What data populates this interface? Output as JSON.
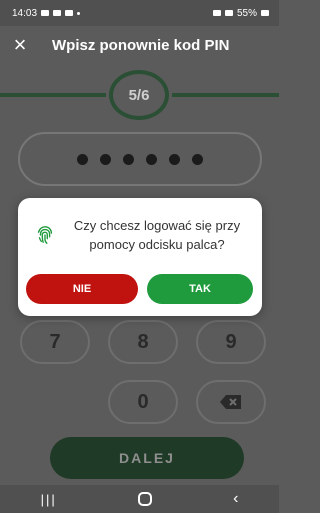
{
  "status_bar": {
    "time": "14:03",
    "battery": "55%"
  },
  "header": {
    "close_icon": "×",
    "title": "Wpisz ponownie kod PIN"
  },
  "progress": {
    "step_text": "5/6"
  },
  "pin": {
    "filled_count": 6
  },
  "dialog": {
    "question": "Czy chcesz logować się przy pomocy odcisku palca?",
    "no_label": "NIE",
    "yes_label": "TAK",
    "icon": "fingerprint-icon",
    "colors": {
      "no": "#c0130f",
      "yes": "#1f9a3c"
    }
  },
  "keypad": {
    "keys": [
      "7",
      "8",
      "9",
      "0"
    ],
    "backspace_icon": "backspace-icon"
  },
  "submit": {
    "label": "DALEJ"
  },
  "nav": {
    "recent": "|||",
    "home": "○",
    "back": "‹"
  }
}
